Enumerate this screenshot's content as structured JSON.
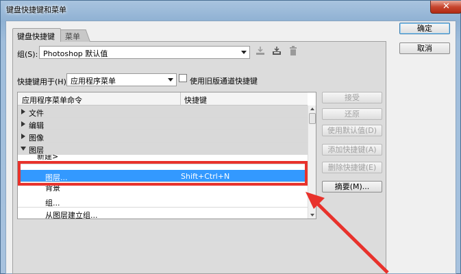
{
  "window": {
    "title": "键盘快捷键和菜单",
    "close_glyph": "✕"
  },
  "tabs": [
    {
      "label": "键盘快捷键"
    },
    {
      "label": "菜单"
    }
  ],
  "group": {
    "label": "组(S):",
    "value": "Photoshop 默认值"
  },
  "toolbar_icons": [
    "save-set-icon",
    "save-set-as-icon",
    "delete-set-icon"
  ],
  "shortcut_for": {
    "label": "快捷键用于(H):",
    "value": "应用程序菜单"
  },
  "legacy_channel": {
    "label": "使用旧版通道快捷键",
    "checked": false
  },
  "table": {
    "headers": [
      "应用程序菜单命令",
      "快捷键"
    ],
    "rows": [
      {
        "command": "文件",
        "shortcut": "",
        "type": "group",
        "expanded": false
      },
      {
        "command": "编辑",
        "shortcut": "",
        "type": "group",
        "expanded": false
      },
      {
        "command": "图像",
        "shortcut": "",
        "type": "group",
        "expanded": false
      },
      {
        "command": "图层",
        "shortcut": "",
        "type": "group",
        "expanded": true
      },
      {
        "command": "新建>",
        "shortcut": "",
        "type": "item"
      },
      {
        "command": "图层...",
        "shortcut": "Shift+Ctrl+N",
        "type": "item",
        "selected": true
      },
      {
        "command": "背景",
        "shortcut": "",
        "type": "item"
      },
      {
        "command": "组...",
        "shortcut": "",
        "type": "item"
      },
      {
        "command": "从图层建立组...",
        "shortcut": "",
        "type": "item"
      }
    ]
  },
  "right_buttons": {
    "accept": "接受",
    "undo": "还原",
    "use_default": "使用默认值(D)",
    "add_shortcut": "添加快捷键(A)",
    "delete_shortcut": "删除快捷键(E)",
    "summary": "摘要(M)..."
  },
  "dialog_buttons": {
    "ok": "确定",
    "cancel": "取消"
  },
  "annotation_color": "#e8322c",
  "selection_color": "#3399ff"
}
